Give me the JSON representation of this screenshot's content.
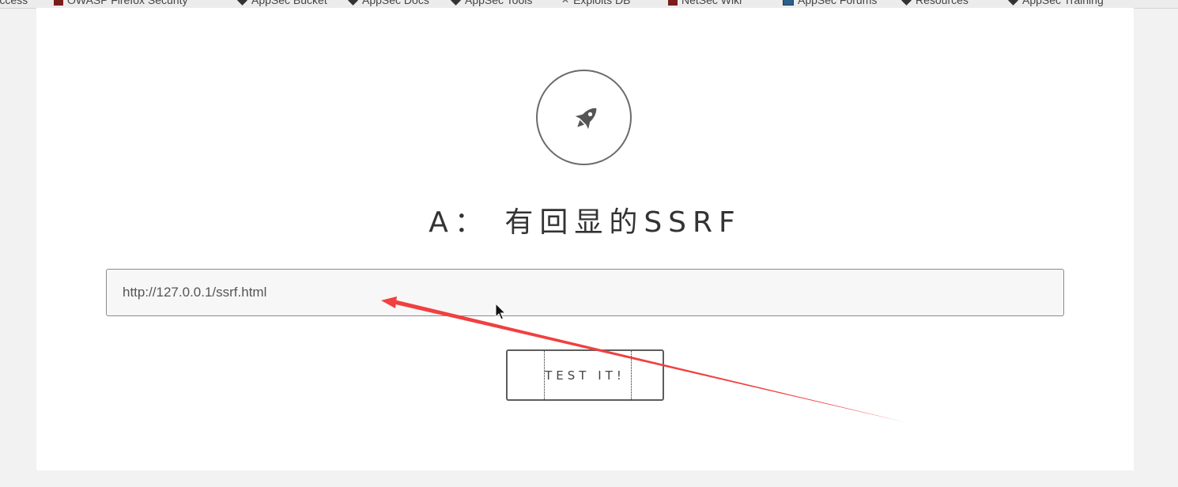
{
  "bookmarks": [
    {
      "label": "Access",
      "icon": "none"
    },
    {
      "label": "OWASP Firefox Security",
      "icon": "firefox-icon"
    },
    {
      "label": "AppSec Bucket",
      "icon": "diamond-icon"
    },
    {
      "label": "AppSec Docs",
      "icon": "diamond-icon"
    },
    {
      "label": "AppSec Tools",
      "icon": "diamond-icon"
    },
    {
      "label": "Exploits DB",
      "icon": "bird-icon"
    },
    {
      "label": "NetSec Wiki",
      "icon": "firefox-icon"
    },
    {
      "label": "AppSec Forums",
      "icon": "doc-icon"
    },
    {
      "label": "Resources",
      "icon": "diamond-icon"
    },
    {
      "label": "AppSec Training",
      "icon": "diamond-icon"
    }
  ],
  "page": {
    "logo_icon": "rocket-icon",
    "title": "A： 有回显的SSRF",
    "url_input": {
      "value": "http://127.0.0.1/ssrf.html"
    },
    "submit_label": "TEST IT!"
  },
  "colors": {
    "annotation_arrow": "#f04040",
    "page_background": "#f2f2f2",
    "card_background": "#ffffff",
    "border": "#6b6b6b"
  }
}
